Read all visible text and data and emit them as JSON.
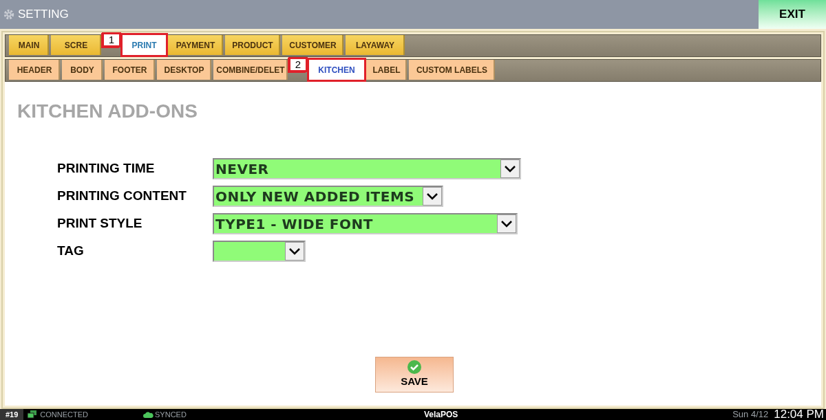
{
  "window": {
    "title": "SETTING"
  },
  "exit_button": "EXIT",
  "tabs": [
    {
      "label": "MAIN",
      "selected": false
    },
    {
      "label": "SCRE",
      "selected": false
    },
    {
      "label": "PRINT",
      "selected": true,
      "annotation": "1"
    },
    {
      "label": "PAYMENT",
      "selected": false
    },
    {
      "label": "PRODUCT",
      "selected": false
    },
    {
      "label": "CUSTOMER",
      "selected": false
    },
    {
      "label": "LAYAWAY",
      "selected": false
    }
  ],
  "subtabs": [
    {
      "label": "HEADER",
      "selected": false
    },
    {
      "label": "BODY",
      "selected": false
    },
    {
      "label": "FOOTER",
      "selected": false
    },
    {
      "label": "DESKTOP",
      "selected": false
    },
    {
      "label": "COMBINE/DELET",
      "selected": false
    },
    {
      "label": "KITCHEN",
      "selected": true,
      "annotation": "2"
    },
    {
      "label": "LABEL",
      "selected": false
    },
    {
      "label": "CUSTOM LABELS",
      "selected": false
    }
  ],
  "heading": "KITCHEN ADD-ONS",
  "fields": [
    {
      "label": "PRINTING TIME",
      "value": "NEVER"
    },
    {
      "label": "PRINTING CONTENT",
      "value": "ONLY NEW ADDED ITEMS"
    },
    {
      "label": "PRINT STYLE",
      "value": "TYPE1 - WIDE FONT"
    },
    {
      "label": "TAG"
    }
  ],
  "save_button": "SAVE",
  "status_bar": {
    "station": "#19",
    "connection": "CONNECTED",
    "sync": "SYNCED",
    "brand": "VelaPOS",
    "date": "Sun 4/12",
    "time": "12:04 PM"
  }
}
